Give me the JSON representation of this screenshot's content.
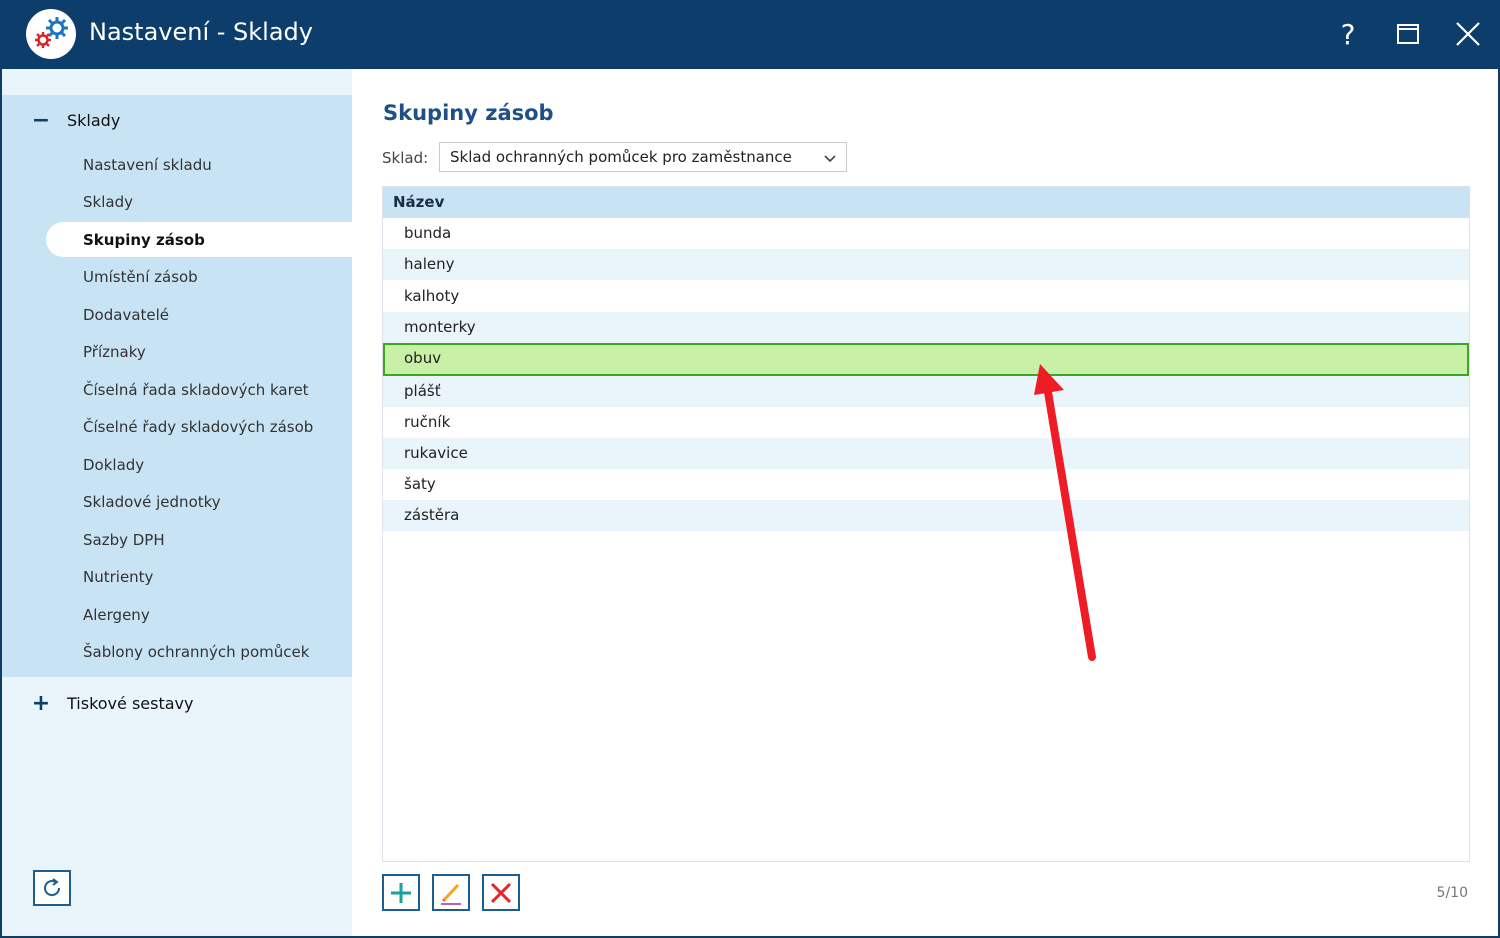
{
  "window": {
    "title": "Nastavení - Sklady",
    "controls": {
      "help": "?"
    }
  },
  "sidebar": {
    "group1": {
      "sign": "−",
      "label": "Sklady",
      "items": [
        {
          "label": "Nastavení skladu"
        },
        {
          "label": "Sklady"
        },
        {
          "label": "Skupiny zásob",
          "active": true
        },
        {
          "label": "Umístění zásob"
        },
        {
          "label": "Dodavatelé"
        },
        {
          "label": "Příznaky"
        },
        {
          "label": "Číselná řada skladových karet"
        },
        {
          "label": "Číselné řady skladových zásob"
        },
        {
          "label": "Doklady"
        },
        {
          "label": "Skladové jednotky"
        },
        {
          "label": "Sazby DPH"
        },
        {
          "label": "Nutrienty"
        },
        {
          "label": "Alergeny"
        },
        {
          "label": "Šablony ochranných pomůcek"
        }
      ]
    },
    "group2": {
      "sign": "+",
      "label": "Tiskové sestavy"
    }
  },
  "main": {
    "title": "Skupiny zásob",
    "sklad": {
      "label": "Sklad:",
      "value": "Sklad ochranných pomůcek pro zaměstnance"
    },
    "grid": {
      "column": "Název",
      "rows": [
        {
          "name": "bunda"
        },
        {
          "name": "haleny"
        },
        {
          "name": "kalhoty"
        },
        {
          "name": "monterky"
        },
        {
          "name": "obuv",
          "selected": true
        },
        {
          "name": "plášť"
        },
        {
          "name": "ručník"
        },
        {
          "name": "rukavice"
        },
        {
          "name": "šaty"
        },
        {
          "name": "zástěra"
        }
      ]
    },
    "counter": "5/10"
  },
  "colors": {
    "titlebar": "#0c3d6b",
    "accent": "#1e4f86",
    "selection_fill": "#c9f0a7",
    "selection_border": "#3fa328",
    "add": "#17a2a0",
    "delete": "#e5262b",
    "annotation_arrow": "#ee1c25"
  },
  "icons": {
    "app": "gears-icon",
    "help": "help-icon",
    "maximize": "maximize-icon",
    "close": "close-icon",
    "refresh": "refresh-icon",
    "add": "plus-icon",
    "edit": "pencil-icon",
    "delete": "x-icon"
  }
}
